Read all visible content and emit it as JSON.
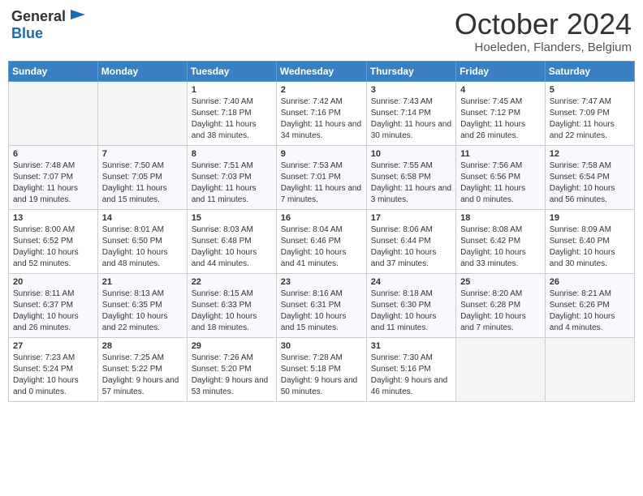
{
  "header": {
    "logo_general": "General",
    "logo_blue": "Blue",
    "month_title": "October 2024",
    "location": "Hoeleden, Flanders, Belgium"
  },
  "weekdays": [
    "Sunday",
    "Monday",
    "Tuesday",
    "Wednesday",
    "Thursday",
    "Friday",
    "Saturday"
  ],
  "weeks": [
    [
      {
        "day": "",
        "info": ""
      },
      {
        "day": "",
        "info": ""
      },
      {
        "day": "1",
        "info": "Sunrise: 7:40 AM\nSunset: 7:18 PM\nDaylight: 11 hours and 38 minutes."
      },
      {
        "day": "2",
        "info": "Sunrise: 7:42 AM\nSunset: 7:16 PM\nDaylight: 11 hours and 34 minutes."
      },
      {
        "day": "3",
        "info": "Sunrise: 7:43 AM\nSunset: 7:14 PM\nDaylight: 11 hours and 30 minutes."
      },
      {
        "day": "4",
        "info": "Sunrise: 7:45 AM\nSunset: 7:12 PM\nDaylight: 11 hours and 26 minutes."
      },
      {
        "day": "5",
        "info": "Sunrise: 7:47 AM\nSunset: 7:09 PM\nDaylight: 11 hours and 22 minutes."
      }
    ],
    [
      {
        "day": "6",
        "info": "Sunrise: 7:48 AM\nSunset: 7:07 PM\nDaylight: 11 hours and 19 minutes."
      },
      {
        "day": "7",
        "info": "Sunrise: 7:50 AM\nSunset: 7:05 PM\nDaylight: 11 hours and 15 minutes."
      },
      {
        "day": "8",
        "info": "Sunrise: 7:51 AM\nSunset: 7:03 PM\nDaylight: 11 hours and 11 minutes."
      },
      {
        "day": "9",
        "info": "Sunrise: 7:53 AM\nSunset: 7:01 PM\nDaylight: 11 hours and 7 minutes."
      },
      {
        "day": "10",
        "info": "Sunrise: 7:55 AM\nSunset: 6:58 PM\nDaylight: 11 hours and 3 minutes."
      },
      {
        "day": "11",
        "info": "Sunrise: 7:56 AM\nSunset: 6:56 PM\nDaylight: 11 hours and 0 minutes."
      },
      {
        "day": "12",
        "info": "Sunrise: 7:58 AM\nSunset: 6:54 PM\nDaylight: 10 hours and 56 minutes."
      }
    ],
    [
      {
        "day": "13",
        "info": "Sunrise: 8:00 AM\nSunset: 6:52 PM\nDaylight: 10 hours and 52 minutes."
      },
      {
        "day": "14",
        "info": "Sunrise: 8:01 AM\nSunset: 6:50 PM\nDaylight: 10 hours and 48 minutes."
      },
      {
        "day": "15",
        "info": "Sunrise: 8:03 AM\nSunset: 6:48 PM\nDaylight: 10 hours and 44 minutes."
      },
      {
        "day": "16",
        "info": "Sunrise: 8:04 AM\nSunset: 6:46 PM\nDaylight: 10 hours and 41 minutes."
      },
      {
        "day": "17",
        "info": "Sunrise: 8:06 AM\nSunset: 6:44 PM\nDaylight: 10 hours and 37 minutes."
      },
      {
        "day": "18",
        "info": "Sunrise: 8:08 AM\nSunset: 6:42 PM\nDaylight: 10 hours and 33 minutes."
      },
      {
        "day": "19",
        "info": "Sunrise: 8:09 AM\nSunset: 6:40 PM\nDaylight: 10 hours and 30 minutes."
      }
    ],
    [
      {
        "day": "20",
        "info": "Sunrise: 8:11 AM\nSunset: 6:37 PM\nDaylight: 10 hours and 26 minutes."
      },
      {
        "day": "21",
        "info": "Sunrise: 8:13 AM\nSunset: 6:35 PM\nDaylight: 10 hours and 22 minutes."
      },
      {
        "day": "22",
        "info": "Sunrise: 8:15 AM\nSunset: 6:33 PM\nDaylight: 10 hours and 18 minutes."
      },
      {
        "day": "23",
        "info": "Sunrise: 8:16 AM\nSunset: 6:31 PM\nDaylight: 10 hours and 15 minutes."
      },
      {
        "day": "24",
        "info": "Sunrise: 8:18 AM\nSunset: 6:30 PM\nDaylight: 10 hours and 11 minutes."
      },
      {
        "day": "25",
        "info": "Sunrise: 8:20 AM\nSunset: 6:28 PM\nDaylight: 10 hours and 7 minutes."
      },
      {
        "day": "26",
        "info": "Sunrise: 8:21 AM\nSunset: 6:26 PM\nDaylight: 10 hours and 4 minutes."
      }
    ],
    [
      {
        "day": "27",
        "info": "Sunrise: 7:23 AM\nSunset: 5:24 PM\nDaylight: 10 hours and 0 minutes."
      },
      {
        "day": "28",
        "info": "Sunrise: 7:25 AM\nSunset: 5:22 PM\nDaylight: 9 hours and 57 minutes."
      },
      {
        "day": "29",
        "info": "Sunrise: 7:26 AM\nSunset: 5:20 PM\nDaylight: 9 hours and 53 minutes."
      },
      {
        "day": "30",
        "info": "Sunrise: 7:28 AM\nSunset: 5:18 PM\nDaylight: 9 hours and 50 minutes."
      },
      {
        "day": "31",
        "info": "Sunrise: 7:30 AM\nSunset: 5:16 PM\nDaylight: 9 hours and 46 minutes."
      },
      {
        "day": "",
        "info": ""
      },
      {
        "day": "",
        "info": ""
      }
    ]
  ]
}
